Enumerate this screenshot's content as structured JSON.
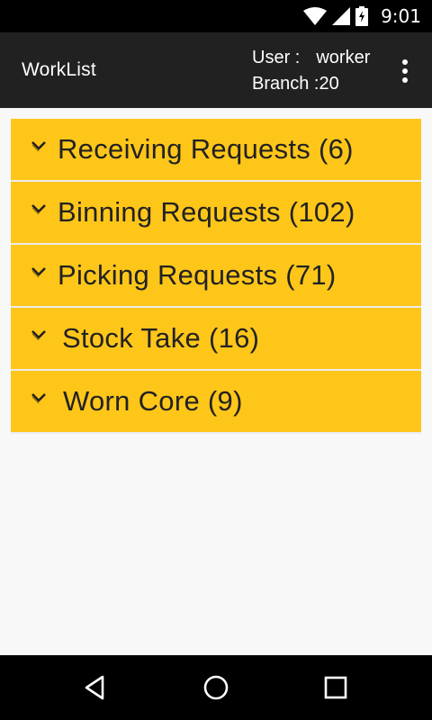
{
  "status_bar": {
    "time": "9:01",
    "icons": [
      "wifi-icon",
      "cell-signal-icon",
      "battery-charging-icon"
    ]
  },
  "app_bar": {
    "title": "WorkList",
    "user_label": "User :",
    "user_value": "worker",
    "branch_text": "Branch :20",
    "menu_icon": "overflow-menu-icon"
  },
  "worklist": {
    "items": [
      {
        "label": "Receiving Requests (6)",
        "icon": "chevron-down-icon"
      },
      {
        "label": "Binning Requests (102)",
        "icon": "chevron-down-icon"
      },
      {
        "label": "Picking Requests (71)",
        "icon": "chevron-down-icon"
      },
      {
        "label": "Stock Take (16)",
        "icon": "chevron-down-icon"
      },
      {
        "label": "Worn Core (9)",
        "icon": "chevron-down-icon"
      }
    ]
  },
  "nav_bar": {
    "icons": [
      "back-icon",
      "home-icon",
      "recents-icon"
    ]
  },
  "colors": {
    "status_bar": "#000000",
    "app_bar": "#212121",
    "item_background": "#FFC61A",
    "page_background": "#f8f8f8",
    "nav_bar": "#000000"
  }
}
